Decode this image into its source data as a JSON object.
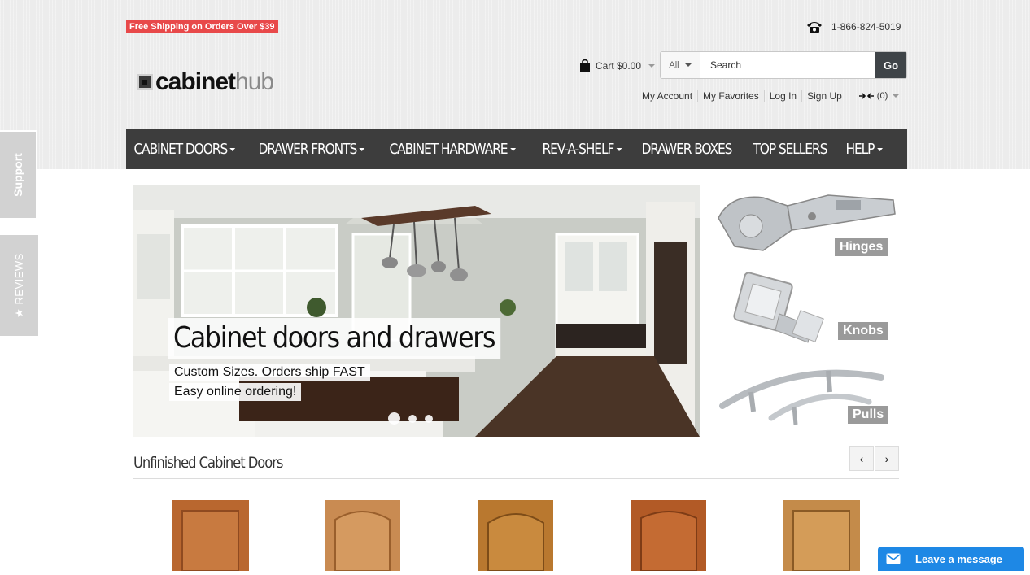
{
  "promo": "Free Shipping on Orders Over $39",
  "phone": "1-866-824-5019",
  "logo": {
    "part1": "cabinet",
    "part2": "hub"
  },
  "cart": {
    "label": "Cart $0.00"
  },
  "search": {
    "scope": "All",
    "placeholder": "Search",
    "go": "Go"
  },
  "account_links": [
    "My Account",
    "My Favorites",
    "Log In",
    "Sign Up"
  ],
  "compare_count": "(0)",
  "nav": [
    {
      "label": "CABINET DOORS",
      "dropdown": true
    },
    {
      "label": "DRAWER FRONTS",
      "dropdown": true
    },
    {
      "label": "CABINET HARDWARE",
      "dropdown": true
    },
    {
      "label": "REV-A-SHELF",
      "dropdown": true
    },
    {
      "label": "DRAWER BOXES",
      "dropdown": false
    },
    {
      "label": "TOP SELLERS",
      "dropdown": false
    },
    {
      "label": "HELP",
      "dropdown": true
    }
  ],
  "side_tabs": {
    "support": "Support",
    "reviews": "★ REVIEWS"
  },
  "hero": {
    "title": "Cabinet doors and drawers",
    "line1": "Custom Sizes. Orders ship FAST",
    "line2": "Easy online ordering!",
    "slide_count": 3,
    "active_slide": 1
  },
  "categories": [
    "Hinges",
    "Knobs",
    "Pulls"
  ],
  "section": {
    "title": "Unfinished Cabinet Doors"
  },
  "carousel": {
    "prev": "‹",
    "next": "›"
  },
  "chat": {
    "label": "Leave a message"
  },
  "colors": {
    "nav_bg": "#3d3d3d",
    "promo_bg": "#e8494a",
    "chat_bg": "#1e88e5",
    "label_bg": "#9a9a9a"
  }
}
